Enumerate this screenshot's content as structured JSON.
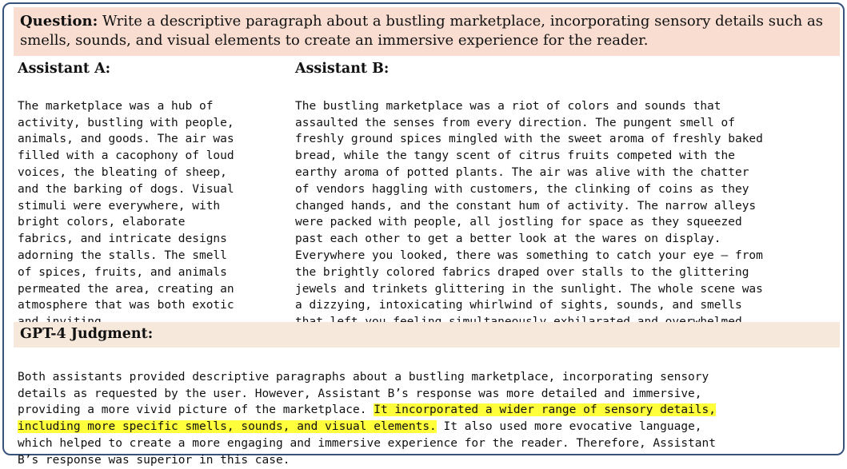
{
  "question": {
    "label": "Question:",
    "text": "Write a descriptive paragraph about a bustling marketplace, incorporating sensory details such as smells, sounds, and visual elements to create an immersive experience for the reader."
  },
  "assistant_a": {
    "heading": "Assistant A:",
    "lines": [
      "The marketplace was a hub of",
      "activity, bustling with people,",
      "animals, and goods. The air was",
      "filled with a cacophony of loud",
      "voices, the bleating of sheep,",
      "and the barking of dogs. Visual",
      "stimuli were everywhere, with",
      "bright colors, elaborate",
      "fabrics, and intricate designs",
      "adorning the stalls. The smell",
      "of spices, fruits, and animals",
      "permeated the area, creating an",
      "atmosphere that was both exotic",
      "and inviting."
    ]
  },
  "assistant_b": {
    "heading": "Assistant B:",
    "lines": [
      "The bustling marketplace was a riot of colors and sounds that",
      "assaulted the senses from every direction. The pungent smell of",
      "freshly ground spices mingled with the sweet aroma of freshly baked",
      "bread, while the tangy scent of citrus fruits competed with the",
      "earthy aroma of potted plants. The air was alive with the chatter",
      "of vendors haggling with customers, the clinking of coins as they",
      "changed hands, and the constant hum of activity. The narrow alleys",
      "were packed with people, all jostling for space as they squeezed",
      "past each other to get a better look at the wares on display.",
      "Everywhere you looked, there was something to catch your eye – from",
      "the brightly colored fabrics draped over stalls to the glittering",
      "jewels and trinkets glittering in the sunlight. The whole scene was",
      "a dizzying, intoxicating whirlwind of sights, sounds, and smells",
      "that left you feeling simultaneously exhilarated and overwhelmed."
    ]
  },
  "judgment": {
    "heading": "GPT-4 Judgment:",
    "line1": "Both assistants provided descriptive paragraphs about a bustling marketplace, incorporating sensory",
    "line2": "details as requested by the user. However, Assistant B’s response was more detailed and immersive,",
    "line3_plain": "providing a more vivid picture of the marketplace. ",
    "line3_highlight": "It incorporated a wider range of sensory details,",
    "line4_highlight": "including more specific smells, sounds, and visual elements.",
    "line4_plain": " It also used more evocative language,",
    "line5": "which helped to create a more engaging and immersive experience for the reader. Therefore, Assistant",
    "line6": "B’s response was superior in this case.",
    "highlight_color": "#ffff3c"
  },
  "colors": {
    "frame_border": "#37527c",
    "question_bg": "#f9ddd1",
    "judgment_header_bg": "#f7e8dc"
  }
}
